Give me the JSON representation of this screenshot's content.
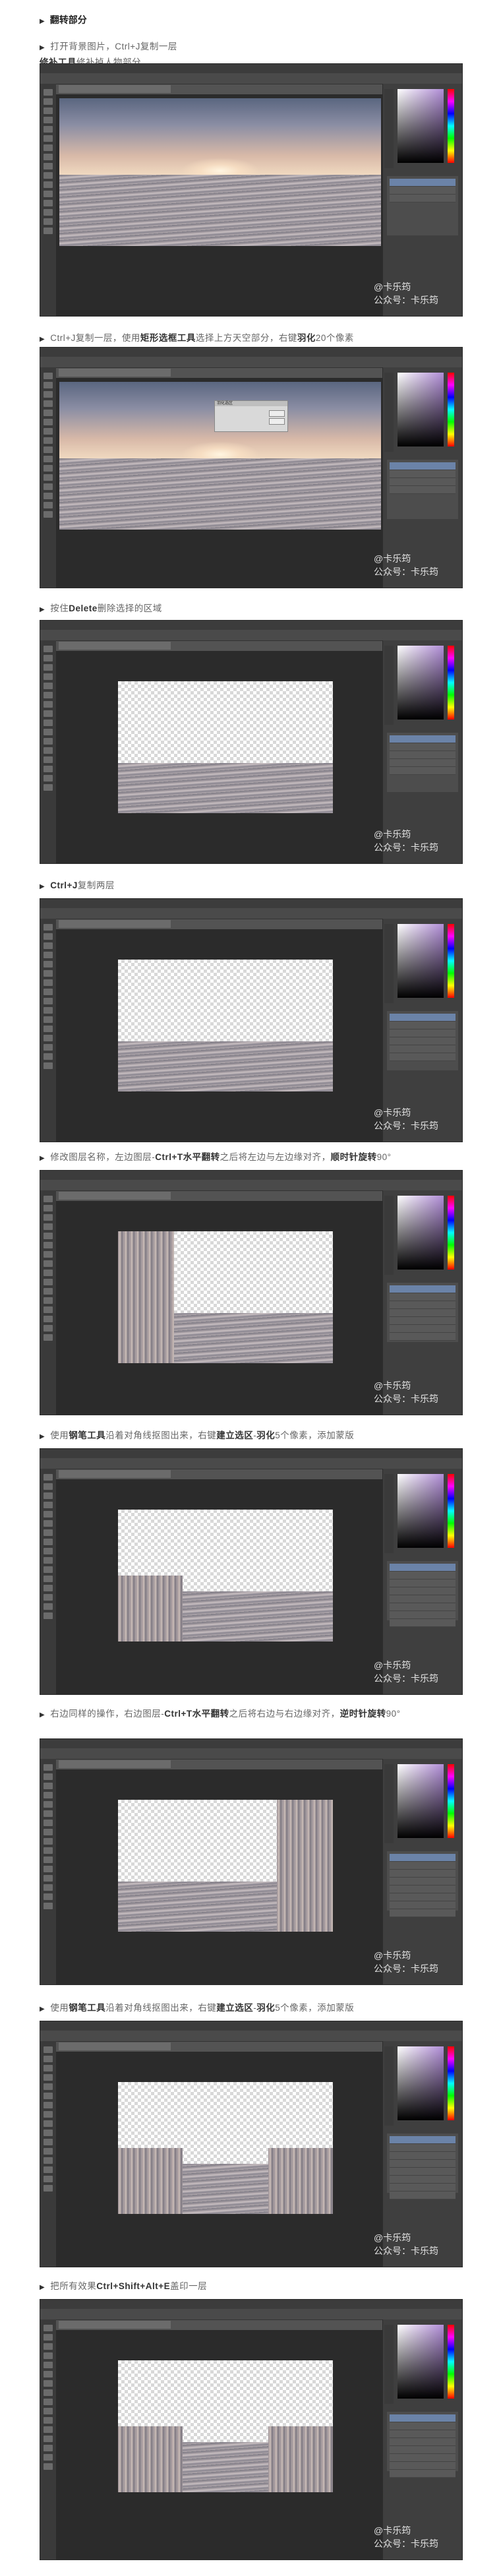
{
  "heading": "翻转部分",
  "watermark": {
    "line1": "@卡乐筠",
    "line2": "公众号：卡乐筠"
  },
  "dialog_title": "羽化选区",
  "steps": [
    {
      "id": 1,
      "parts": [
        {
          "t": "打开背景图片，Ctrl+J复制一层",
          "b": false
        },
        {
          "t": "\n",
          "b": false
        },
        {
          "t": "修补工具",
          "b": true
        },
        {
          "t": "修补掉人物部分",
          "b": false
        }
      ]
    },
    {
      "id": 2,
      "parts": [
        {
          "t": "Ctrl+J复制一层，使用",
          "b": false
        },
        {
          "t": "矩形选框工具",
          "b": true
        },
        {
          "t": "选择上方天空部分，右键",
          "b": false
        },
        {
          "t": "羽化",
          "b": true
        },
        {
          "t": "20个像素",
          "b": false
        }
      ]
    },
    {
      "id": 3,
      "parts": [
        {
          "t": "按住",
          "b": false
        },
        {
          "t": "Delete",
          "b": true
        },
        {
          "t": "删除选择的区域",
          "b": false
        }
      ]
    },
    {
      "id": 4,
      "parts": [
        {
          "t": "Ctrl+J",
          "b": true
        },
        {
          "t": "复制两层",
          "b": false
        }
      ]
    },
    {
      "id": 5,
      "parts": [
        {
          "t": "修改图层名称，左边图层-",
          "b": false
        },
        {
          "t": "Ctrl+T水平翻转",
          "b": true
        },
        {
          "t": "之后将左边与左边缘对齐，",
          "b": false
        },
        {
          "t": "顺时针旋转",
          "b": true
        },
        {
          "t": "90°",
          "b": false
        }
      ]
    },
    {
      "id": 6,
      "parts": [
        {
          "t": "使用",
          "b": false
        },
        {
          "t": "钢笔工具",
          "b": true
        },
        {
          "t": "沿着对角线抠图出来，右键",
          "b": false
        },
        {
          "t": "建立选区",
          "b": true
        },
        {
          "t": "-",
          "b": false
        },
        {
          "t": "羽化",
          "b": true
        },
        {
          "t": "5个像素，添加蒙版",
          "b": false
        }
      ]
    },
    {
      "id": 7,
      "parts": [
        {
          "t": "右边同样的操作，右边图层-",
          "b": false
        },
        {
          "t": "Ctrl+T水平翻转",
          "b": true
        },
        {
          "t": "之后将右边与右边缘对齐，",
          "b": false
        },
        {
          "t": "逆时针旋转",
          "b": true
        },
        {
          "t": "90°",
          "b": false
        }
      ]
    },
    {
      "id": 8,
      "parts": [
        {
          "t": "使用",
          "b": false
        },
        {
          "t": "钢笔工具",
          "b": true
        },
        {
          "t": "沿着对角线抠图出来，右键",
          "b": false
        },
        {
          "t": "建立选区",
          "b": true
        },
        {
          "t": "-",
          "b": false
        },
        {
          "t": "羽化",
          "b": true
        },
        {
          "t": "5个像素，添加蒙版",
          "b": false
        }
      ]
    },
    {
      "id": 9,
      "parts": [
        {
          "t": "把所有效果",
          "b": false
        },
        {
          "t": "Ctrl+Shift+Alt+E",
          "b": true
        },
        {
          "t": "盖印一层",
          "b": false
        }
      ]
    }
  ]
}
